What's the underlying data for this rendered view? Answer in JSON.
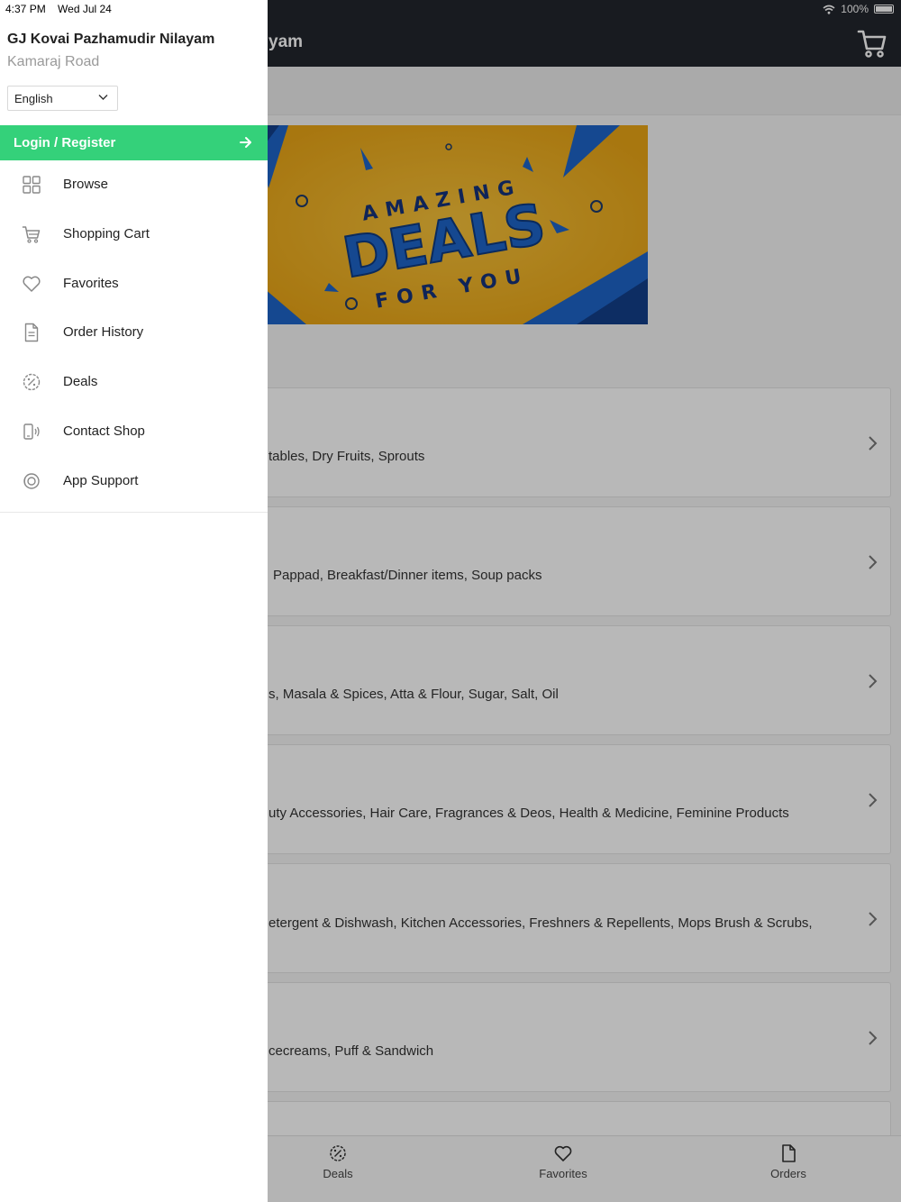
{
  "status_bar": {
    "time": "4:37 PM",
    "date": "Wed Jul 24",
    "battery": "100%"
  },
  "background": {
    "header_title_visible": "yam",
    "categories": [
      {
        "subtitle": "tables, Dry Fruits, Sprouts"
      },
      {
        "subtitle": "Pappad, Breakfast/Dinner items, Soup packs"
      },
      {
        "subtitle": "s, Masala & Spices, Atta & Flour, Sugar, Salt, Oil"
      },
      {
        "subtitle": "uty Accessories, Hair Care, Fragrances & Deos, Health & Medicine, Feminine Products"
      },
      {
        "subtitle": "etergent & Dishwash, Kitchen Accessories, Freshners & Repellents, Mops Brush & Scrubs,"
      },
      {
        "subtitle": "cecreams, Puff & Sandwich"
      }
    ],
    "tabs": [
      {
        "label": "Deals",
        "icon": "deals-icon"
      },
      {
        "label": "Favorites",
        "icon": "heart-icon"
      },
      {
        "label": "Orders",
        "icon": "document-icon"
      }
    ]
  },
  "drawer": {
    "store_name": "GJ Kovai Pazhamudir Nilayam",
    "store_location": "Kamaraj Road",
    "language": "English",
    "login_label": "Login / Register",
    "menu": [
      {
        "label": "Browse",
        "icon": "grid-icon"
      },
      {
        "label": "Shopping Cart",
        "icon": "cart-icon"
      },
      {
        "label": "Favorites",
        "icon": "heart-icon"
      },
      {
        "label": "Order History",
        "icon": "document-icon"
      },
      {
        "label": "Deals",
        "icon": "deals-badge-icon"
      },
      {
        "label": "Contact Shop",
        "icon": "phone-icon"
      },
      {
        "label": "App Support",
        "icon": "support-icon"
      }
    ]
  },
  "colors": {
    "accent_green": "#34d17a",
    "header_dark": "#22262d",
    "banner_yellow": "#f4b521",
    "banner_blue": "#1e64c8"
  }
}
